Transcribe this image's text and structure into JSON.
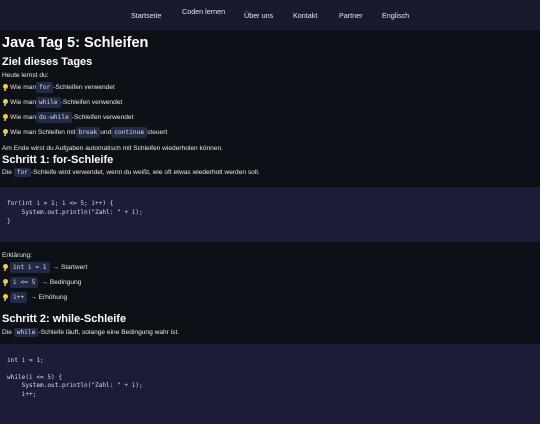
{
  "nav": {
    "items": [
      "Startseite",
      "Coden lernen",
      "Über uns",
      "Kontakt",
      "Partner",
      "Englisch"
    ]
  },
  "page_title": "Java Tag 5: Schleifen",
  "goals": {
    "heading": "Ziel dieses Tages",
    "intro": "Heute lernst du:",
    "items": [
      {
        "pre": "Wie man ",
        "code": "for",
        "post": "-Schleifen verwendet"
      },
      {
        "pre": "Wie man ",
        "code": "while",
        "post": "-Schleifen verwendet"
      },
      {
        "pre": "Wie man ",
        "code": "do-while",
        "post": "-Schleifen verwendet"
      },
      {
        "pre": "Wie man Schleifen mit ",
        "code": "break",
        "mid": " und ",
        "code2": "continue",
        "post": " steuert"
      }
    ],
    "outro": "Am Ende wirst du Aufgaben automatisch mit Schleifen wiederholen können."
  },
  "step1": {
    "heading": "Schritt 1: for-Schleife",
    "desc_pre": "Die ",
    "desc_code": "for",
    "desc_post": "-Schleife wird verwendet, wenn du weißt, wie oft etwas wiederholt werden soll.",
    "code": "for(int i = 1; i <= 5; i++) {\n    System.out.println(\"Zahl: \" + i);\n}",
    "explain_label": "Erklärung:",
    "explain_items": [
      {
        "code": "int i = 1",
        "text": "→ Startwert"
      },
      {
        "code": "i <= 5",
        "text": "→ Bedingung"
      },
      {
        "code": "i++",
        "text": "→ Erhöhung"
      }
    ]
  },
  "step2": {
    "heading": "Schritt 2: while-Schleife",
    "desc_pre": "Die ",
    "desc_code": "while",
    "desc_post": "-Schleife läuft, solange eine Bedingung wahr ist.",
    "code": "int i = 1;\n\nwhile(i <= 5) {\n    System.out.println(\"Zahl: \" + i);\n    i++;"
  }
}
